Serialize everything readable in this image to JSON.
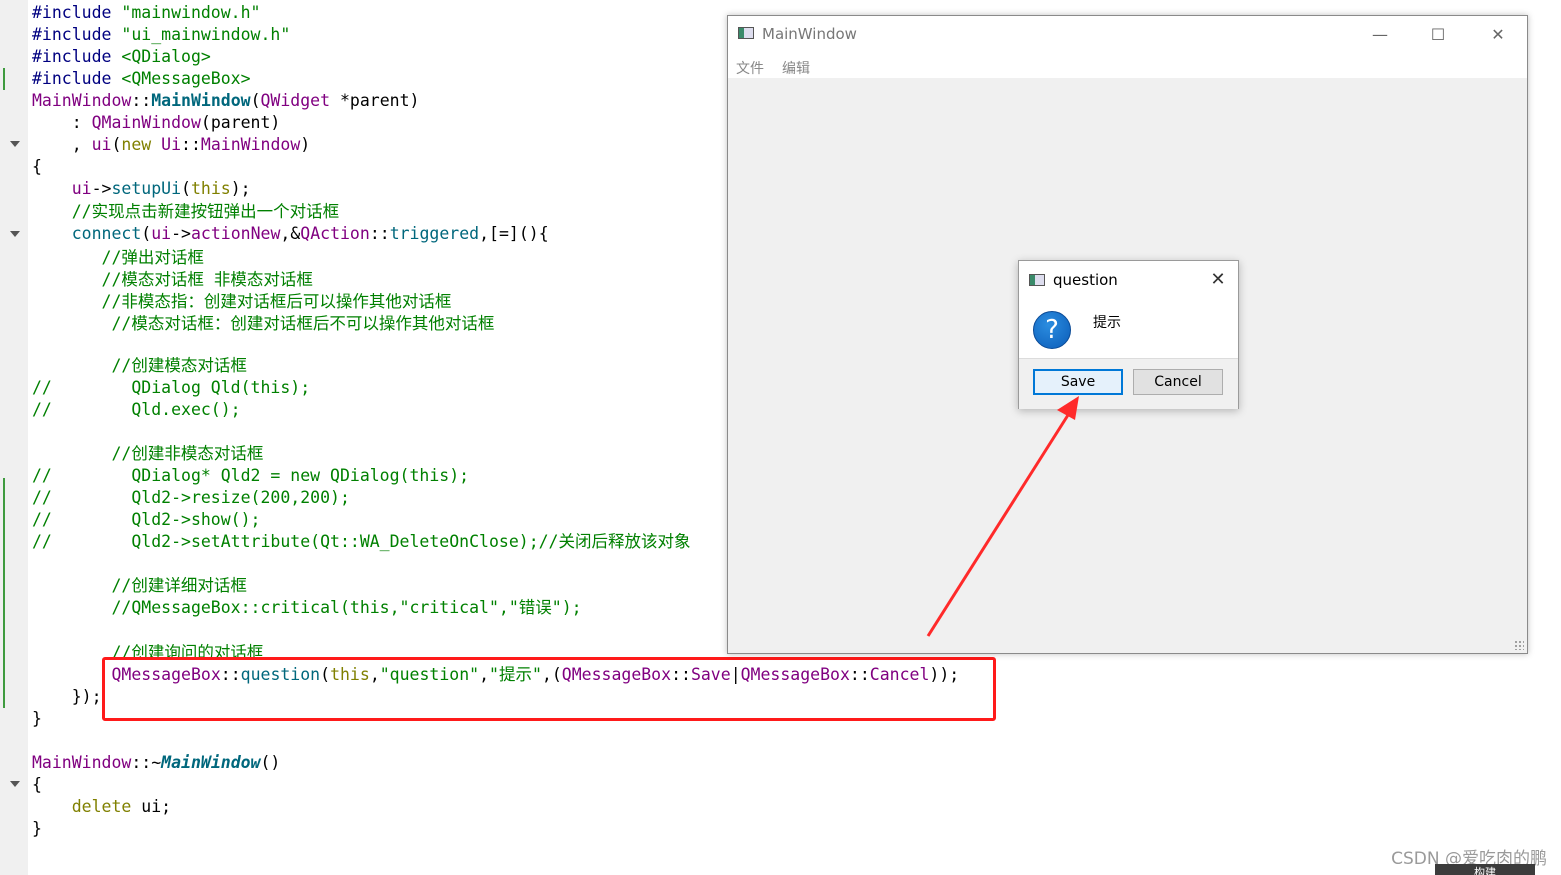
{
  "editor": {
    "lines": [
      {
        "segs": [
          [
            "pp",
            "#include "
          ],
          [
            "str",
            "\"mainwindow.h\""
          ]
        ]
      },
      {
        "segs": [
          [
            "pp",
            "#include "
          ],
          [
            "str",
            "\"ui_mainwindow.h\""
          ]
        ]
      },
      {
        "segs": [
          [
            "pp",
            "#include "
          ],
          [
            "str",
            "<QDialog>"
          ]
        ]
      },
      {
        "segs": [
          [
            "pp",
            "#include "
          ],
          [
            "str",
            "<QMessageBox>"
          ]
        ]
      },
      {
        "segs": [
          [
            "cls",
            "MainWindow"
          ],
          [
            "op",
            "::"
          ],
          [
            "fnb",
            "MainWindow"
          ],
          [
            "op",
            "("
          ],
          [
            "cls",
            "QWidget"
          ],
          [
            "op",
            " *parent)"
          ]
        ]
      },
      {
        "segs": [
          [
            "op",
            "    : "
          ],
          [
            "cls",
            "QMainWindow"
          ],
          [
            "op",
            "(parent)"
          ]
        ]
      },
      {
        "segs": [
          [
            "op",
            "    , "
          ],
          [
            "cls",
            "ui"
          ],
          [
            "op",
            "("
          ],
          [
            "kw",
            "new"
          ],
          [
            "op",
            " "
          ],
          [
            "cls",
            "Ui"
          ],
          [
            "op",
            "::"
          ],
          [
            "cls",
            "MainWindow"
          ],
          [
            "op",
            ")"
          ]
        ]
      },
      {
        "segs": [
          [
            "op",
            "{"
          ]
        ]
      },
      {
        "segs": [
          [
            "op",
            "    "
          ],
          [
            "cls",
            "ui"
          ],
          [
            "op",
            "->"
          ],
          [
            "fn",
            "setupUi"
          ],
          [
            "op",
            "("
          ],
          [
            "kw",
            "this"
          ],
          [
            "op",
            ");"
          ]
        ]
      },
      {
        "segs": [
          [
            "cm",
            "    //实现点击新建按钮弹出一个对话框"
          ]
        ]
      },
      {
        "segs": [
          [
            "op",
            "    "
          ],
          [
            "fn",
            "connect"
          ],
          [
            "op",
            "("
          ],
          [
            "cls",
            "ui"
          ],
          [
            "op",
            "->"
          ],
          [
            "cls",
            "actionNew"
          ],
          [
            "op",
            ",&"
          ],
          [
            "cls",
            "QAction"
          ],
          [
            "op",
            "::"
          ],
          [
            "fn",
            "triggered"
          ],
          [
            "op",
            ",[=](){"
          ]
        ]
      },
      {
        "segs": [
          [
            "cm",
            "       //弹出对话框"
          ]
        ]
      },
      {
        "segs": [
          [
            "cm",
            "       //模态对话框 非模态对话框"
          ]
        ]
      },
      {
        "segs": [
          [
            "cm",
            "       //非模态指：创建对话框后可以操作其他对话框"
          ]
        ]
      },
      {
        "segs": [
          [
            "cm",
            "        //模态对话框：创建对话框后不可以操作其他对话框"
          ]
        ]
      },
      {
        "segs": [
          [
            "op",
            ""
          ]
        ]
      },
      {
        "segs": [
          [
            "cm",
            "        //创建模态对话框"
          ]
        ]
      },
      {
        "segs": [
          [
            "cm",
            "//        QDialog Qld(this);"
          ]
        ]
      },
      {
        "segs": [
          [
            "cm",
            "//        Qld.exec();"
          ]
        ]
      },
      {
        "segs": [
          [
            "op",
            ""
          ]
        ]
      },
      {
        "segs": [
          [
            "cm",
            "        //创建非模态对话框"
          ]
        ]
      },
      {
        "segs": [
          [
            "cm",
            "//        QDialog* Qld2 = new QDialog(this);"
          ]
        ]
      },
      {
        "segs": [
          [
            "cm",
            "//        Qld2->resize(200,200);"
          ]
        ]
      },
      {
        "segs": [
          [
            "cm",
            "//        Qld2->show();"
          ]
        ]
      },
      {
        "segs": [
          [
            "cm",
            "//        Qld2->setAttribute(Qt::WA_DeleteOnClose);//关闭后释放该对象"
          ]
        ]
      },
      {
        "segs": [
          [
            "op",
            ""
          ]
        ]
      },
      {
        "segs": [
          [
            "cm",
            "        //创建详细对话框"
          ]
        ]
      },
      {
        "segs": [
          [
            "cm",
            "        //QMessageBox::critical(this,\"critical\",\"错误\");"
          ]
        ]
      },
      {
        "segs": [
          [
            "op",
            ""
          ]
        ]
      },
      {
        "segs": [
          [
            "cm",
            "        //创建询问的对话框"
          ]
        ]
      },
      {
        "segs": [
          [
            "op",
            "        "
          ],
          [
            "cls",
            "QMessageBox"
          ],
          [
            "op",
            "::"
          ],
          [
            "fn",
            "question"
          ],
          [
            "op",
            "("
          ],
          [
            "kw",
            "this"
          ],
          [
            "op",
            ","
          ],
          [
            "str",
            "\"question\""
          ],
          [
            "op",
            ","
          ],
          [
            "str",
            "\"提示\""
          ],
          [
            "op",
            ",("
          ],
          [
            "cls",
            "QMessageBox"
          ],
          [
            "op",
            "::"
          ],
          [
            "en",
            "Save"
          ],
          [
            "op",
            "|"
          ],
          [
            "cls",
            "QMessageBox"
          ],
          [
            "op",
            "::"
          ],
          [
            "en",
            "Cancel"
          ],
          [
            "op",
            "));"
          ]
        ]
      },
      {
        "segs": [
          [
            "op",
            "    });"
          ]
        ]
      },
      {
        "segs": [
          [
            "op",
            "}"
          ]
        ]
      },
      {
        "segs": [
          [
            "op",
            ""
          ]
        ]
      },
      {
        "segs": [
          [
            "cls",
            "MainWindow"
          ],
          [
            "op",
            "::~"
          ],
          [
            "fni",
            "MainWindow"
          ],
          [
            "op",
            "()"
          ]
        ]
      },
      {
        "segs": [
          [
            "op",
            "{"
          ]
        ]
      },
      {
        "segs": [
          [
            "op",
            "    "
          ],
          [
            "kw",
            "delete"
          ],
          [
            "op",
            " ui;"
          ]
        ]
      },
      {
        "segs": [
          [
            "op",
            "}"
          ]
        ]
      }
    ]
  },
  "main_window": {
    "title": "MainWindow",
    "minimize_glyph": "—",
    "maximize_glyph": "☐",
    "close_glyph": "✕",
    "menus": [
      "文件",
      "编辑"
    ]
  },
  "message_box": {
    "title": "question",
    "close_glyph": "✕",
    "icon_glyph": "?",
    "text": "提示",
    "save_label": "Save",
    "cancel_label": "Cancel"
  },
  "colors": {
    "highlight_border": "#ff1a1a",
    "arrow": "#ff2a2a",
    "default_button_border": "#0078d7"
  },
  "watermark": "CSDN @爱吃肉的鹏",
  "bottom_tab_label": "构建"
}
